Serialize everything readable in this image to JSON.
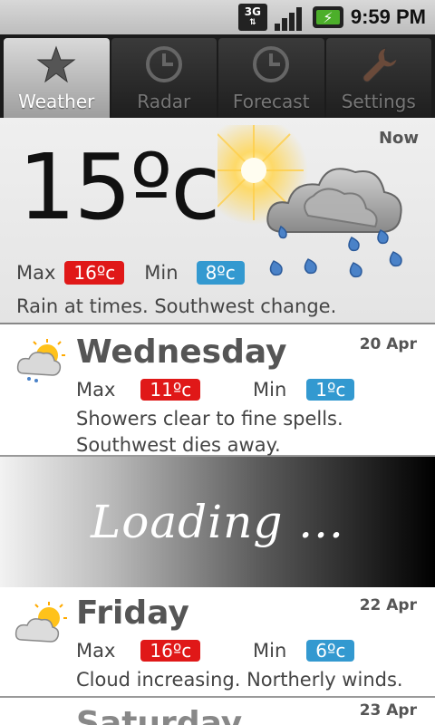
{
  "status_bar": {
    "network": "3G",
    "time": "9:59 PM"
  },
  "tabs": [
    {
      "label": "Weather",
      "icon": "star-icon",
      "active": true
    },
    {
      "label": "Radar",
      "icon": "clock-icon",
      "active": false
    },
    {
      "label": "Forecast",
      "icon": "clock-icon",
      "active": false
    },
    {
      "label": "Settings",
      "icon": "wrench-icon",
      "active": false
    }
  ],
  "now": {
    "label": "Now",
    "temp": "15ºc",
    "max_label": "Max",
    "max": "16ºc",
    "min_label": "Min",
    "min": "8ºc",
    "description": "Rain at times. Southwest change.",
    "icon": "sun-rain-cloud-icon"
  },
  "days": [
    {
      "name": "Wednesday",
      "date": "20 Apr",
      "max_label": "Max",
      "max": "11ºc",
      "min_label": "Min",
      "min": "1ºc",
      "description_line1": "Showers clear to fine spells.",
      "description_line2": "Southwest dies away.",
      "icon": "sun-cloud-rain-icon"
    },
    {
      "name": "Friday",
      "date": "22 Apr",
      "max_label": "Max",
      "max": "16ºc",
      "min_label": "Min",
      "min": "6ºc",
      "description_line1": "Cloud increasing. Northerly winds.",
      "icon": "sun-cloud-icon"
    },
    {
      "name": "Saturday",
      "date": "23 Apr"
    }
  ],
  "loading_text": "Loading ...",
  "colors": {
    "max_badge": "#e01818",
    "min_badge": "#3399d0"
  }
}
